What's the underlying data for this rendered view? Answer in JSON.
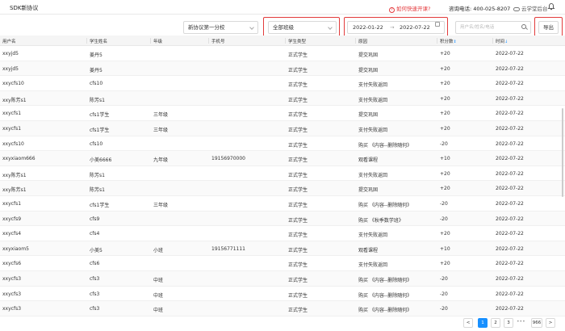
{
  "header": {
    "app_title": "SDK新协议",
    "help_link": "如何快速开课?",
    "phone_label": "咨询电话: 400-025-8207",
    "cloud_link": "云学堂后台"
  },
  "filters": {
    "protocol_select": "新协议第一分校",
    "class_select": "全部班级",
    "date_start": "2022-01-22",
    "date_separator": "→",
    "date_end": "2022-07-22",
    "search_placeholder": "用户名/姓名/电话",
    "export_label": "导出"
  },
  "table": {
    "headers": [
      "用户名",
      "学生姓名",
      "年级",
      "手机号",
      "学生类型",
      "原因",
      "积分数",
      "时间"
    ],
    "sort_indicators": {
      "points": "⇕",
      "time": "↓"
    },
    "rows": [
      [
        "xxyjd5",
        "姜丹5",
        "",
        "",
        "正式学生",
        "提交巩固",
        "+20",
        "2022-07-22"
      ],
      [
        "xxyjd5",
        "姜丹5",
        "",
        "",
        "正式学生",
        "提交巩固",
        "+20",
        "2022-07-22"
      ],
      [
        "xxycfs10",
        "cfs10",
        "",
        "",
        "正式学生",
        "支付失败返回",
        "+20",
        "2022-07-22"
      ],
      [
        "xxy陈芳s1",
        "陈芳s1",
        "",
        "",
        "正式学生",
        "支付失败返回",
        "+20",
        "2022-07-22"
      ],
      [
        "xxycfs1",
        "cfs1学生",
        "三年级",
        "",
        "正式学生",
        "提交巩固",
        "+20",
        "2022-07-22"
      ],
      [
        "xxycfs1",
        "cfs1学生",
        "三年级",
        "",
        "正式学生",
        "支付失败返回",
        "+20",
        "2022-07-22"
      ],
      [
        "xxycfs10",
        "cfs10",
        "",
        "",
        "正式学生",
        "购买 《内容--删除随何》",
        "-20",
        "2022-07-22"
      ],
      [
        "xxyxiaom666",
        "小美6666",
        "九年级",
        "19156970000",
        "正式学生",
        "观看课程",
        "+10",
        "2022-07-22"
      ],
      [
        "xxy陈芳s1",
        "陈芳s1",
        "",
        "",
        "正式学生",
        "支付失败返回",
        "+20",
        "2022-07-22"
      ],
      [
        "xxy陈芳s1",
        "陈芳s1",
        "",
        "",
        "正式学生",
        "提交巩固",
        "+20",
        "2022-07-22"
      ],
      [
        "xxycfs1",
        "cfs1学生",
        "三年级",
        "",
        "正式学生",
        "购买 《内容--删除随何》",
        "-20",
        "2022-07-22"
      ],
      [
        "xxycfs9",
        "cfs9",
        "",
        "",
        "正式学生",
        "购买 《秋季数学班》",
        "-20",
        "2022-07-22"
      ],
      [
        "xxycfs4",
        "cfs4",
        "",
        "",
        "正式学生",
        "支付失败返回",
        "+20",
        "2022-07-22"
      ],
      [
        "xxyxiaom5",
        "小美5",
        "小班",
        "19156771111",
        "正式学生",
        "观看课程",
        "+10",
        "2022-07-22"
      ],
      [
        "xxycfs6",
        "cfs6",
        "",
        "",
        "正式学生",
        "支付失败返回",
        "+20",
        "2022-07-22"
      ],
      [
        "xxycfs3",
        "cfs3",
        "中班",
        "",
        "正式学生",
        "购买 《内容--删除随何》",
        "-20",
        "2022-07-22"
      ],
      [
        "xxycfs3",
        "cfs3",
        "中班",
        "",
        "正式学生",
        "购买 《内容--删除随何》",
        "-20",
        "2022-07-22"
      ],
      [
        "xxycfs3",
        "cfs3",
        "中班",
        "",
        "正式学生",
        "购买 《内容--删除随何》",
        "-20",
        "2022-07-22"
      ]
    ]
  },
  "pagination": {
    "prev": "<",
    "pages": [
      "1",
      "2",
      "3"
    ],
    "ellipsis": "•••",
    "last": "966",
    "next": ">",
    "current": "1"
  },
  "colors": {
    "accent": "#1890ff",
    "highlight_box": "#e23b3b",
    "help_link": "#e4393c"
  },
  "icons": {
    "help": "question-circle-icon",
    "cloud": "cloud-icon",
    "bell": "bell-icon",
    "calendar": "calendar-icon",
    "search": "search-icon",
    "dropdown": "chevron-down-icon"
  }
}
